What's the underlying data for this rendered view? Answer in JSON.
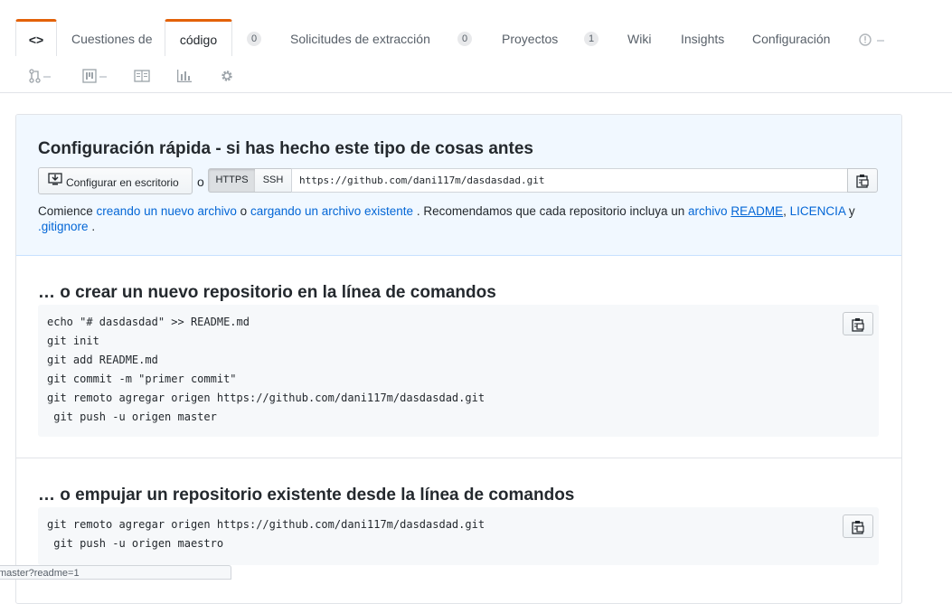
{
  "tabs": {
    "code_icon": "<>",
    "issues_label": "Cuestiones de",
    "code_label": "código",
    "issues_count": "0",
    "pulls_label": "Solicitudes de extracción",
    "pulls_count": "0",
    "projects_label": "Proyectos",
    "projects_count": "1",
    "wiki_label": "Wiki",
    "insights_label": "Insights",
    "settings_label": "Configuración"
  },
  "icons": [
    "code-icon",
    "pull-request-icon",
    "project-icon",
    "book-icon",
    "graph-icon",
    "gear-icon",
    "alert-icon",
    "clipboard-icon",
    "desktop-download-icon"
  ],
  "quick_setup": {
    "title": "Configuración rápida - si has hecho este tipo de cosas antes",
    "desktop_button": "Configurar en escritorio",
    "or": "o",
    "https": "HTTPS",
    "ssh": "SSH",
    "url": "https://github.com/dani117m/dasdasdad.git",
    "text_start": "Comience",
    "link_new_file": "creando un nuevo archivo",
    "text_or": "o",
    "link_upload": "cargando un archivo existente",
    "text_mid": ". Recomendamos que cada repositorio incluya un",
    "link_archivo": "archivo",
    "link_readme": "README",
    "text_comma": ",",
    "link_license": "LICENCIA",
    "text_and": "y",
    "link_gitignore": ".gitignore",
    "text_end": "."
  },
  "new_repo": {
    "title": "… o crear un nuevo repositorio en la línea de comandos",
    "code": "echo \"# dasdasdad\" >> README.md\ngit init\ngit add README.md\ngit commit -m \"primer commit\"\ngit remoto agregar origen https://github.com/dani117m/dasdasdad.git\n git push -u origen master"
  },
  "push_repo": {
    "title": "… o empujar un repositorio existente desde la línea de comandos",
    "code": "git remoto agregar origen https://github.com/dani117m/dasdasdad.git\n git push -u origen maestro"
  },
  "status_bar": "master?readme=1",
  "colors": {
    "tab_accent": "#e36209",
    "link": "#0366d6",
    "quick_setup_bg": "#f1f8ff"
  }
}
